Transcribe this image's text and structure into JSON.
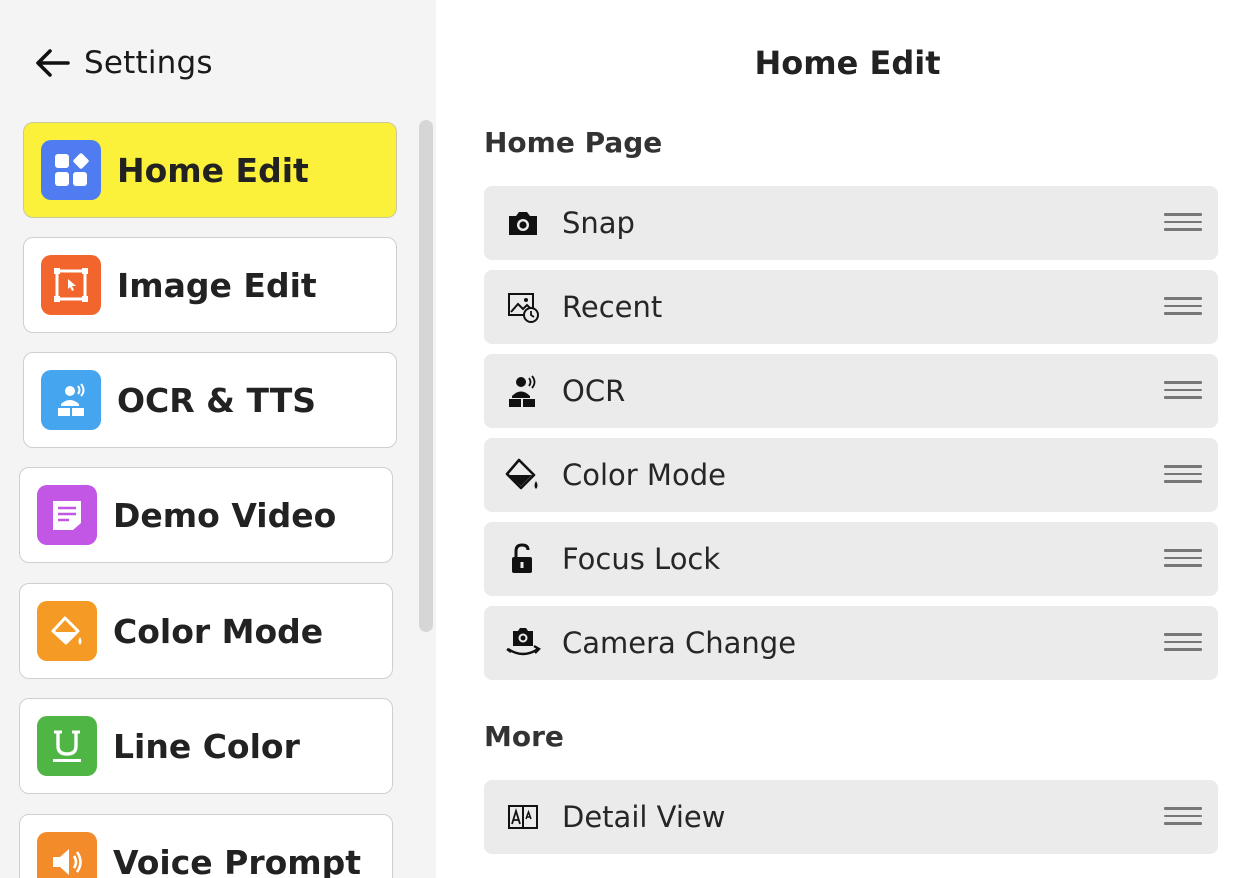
{
  "header": {
    "back_label": "Settings",
    "title": "Home Edit"
  },
  "sidebar": {
    "items": [
      {
        "label": "Home Edit",
        "icon": "grid-icon",
        "color": "#4f7cf0",
        "active": true
      },
      {
        "label": "Image Edit",
        "icon": "crop-icon",
        "color": "#f2662d"
      },
      {
        "label": "OCR & TTS",
        "icon": "reader-icon",
        "color": "#45a6ef"
      },
      {
        "label": "Demo Video",
        "icon": "note-icon",
        "color": "#c257e6"
      },
      {
        "label": "Color Mode",
        "icon": "paint-bucket-icon",
        "color": "#f49a25"
      },
      {
        "label": "Line Color",
        "icon": "underline-icon",
        "color": "#4fb646"
      },
      {
        "label": "Voice Prompt",
        "icon": "speaker-icon",
        "color": "#f48b2a"
      }
    ]
  },
  "sections": {
    "home_page": {
      "title": "Home Page",
      "rows": [
        {
          "label": "Snap",
          "icon": "camera-icon"
        },
        {
          "label": "Recent",
          "icon": "gallery-clock-icon"
        },
        {
          "label": "OCR",
          "icon": "reader-speaking-icon"
        },
        {
          "label": "Color Mode",
          "icon": "paint-bucket-icon"
        },
        {
          "label": "Focus Lock",
          "icon": "unlock-icon"
        },
        {
          "label": "Camera Change",
          "icon": "camera-switch-icon"
        }
      ]
    },
    "more": {
      "title": "More",
      "rows": [
        {
          "label": "Detail View",
          "icon": "text-size-icon"
        }
      ]
    }
  },
  "colors": {
    "active_highlight": "#fbf13a",
    "row_background": "#ebebeb",
    "sidebar_background": "#f4f4f4"
  }
}
